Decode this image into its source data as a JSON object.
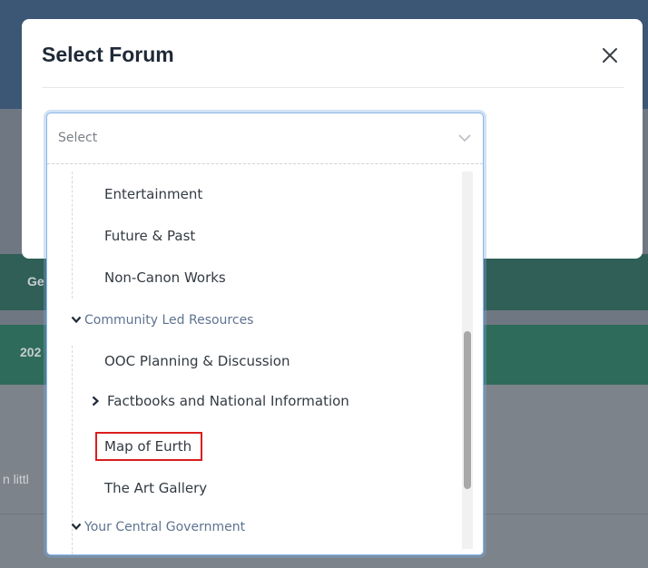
{
  "background": {
    "snippet_1": "Ge",
    "snippet_2": "202",
    "snippet_3": "n littl"
  },
  "modal": {
    "title": "Select Forum",
    "close_icon": "close-icon"
  },
  "select": {
    "placeholder": "Select",
    "caret_icon": "chevron-down-icon",
    "options": [
      {
        "label": "Entertainment",
        "type": "option"
      },
      {
        "label": "Future & Past",
        "type": "option"
      },
      {
        "label": "Non-Canon Works",
        "type": "option"
      },
      {
        "label": "Community Led Resources",
        "type": "group",
        "expanded": true
      },
      {
        "label": "OOC Planning & Discussion",
        "type": "option"
      },
      {
        "label": "Factbooks and National Information",
        "type": "option",
        "expandable": true
      },
      {
        "label": "Map of Eurth",
        "type": "option",
        "highlighted": true
      },
      {
        "label": "The Art Gallery",
        "type": "option"
      },
      {
        "label": "Your Central Government",
        "type": "group",
        "expanded": true
      }
    ]
  },
  "colors": {
    "highlight": "#d91e1e",
    "group_text": "#5e7390",
    "focus_border": "#8bb7e6"
  }
}
